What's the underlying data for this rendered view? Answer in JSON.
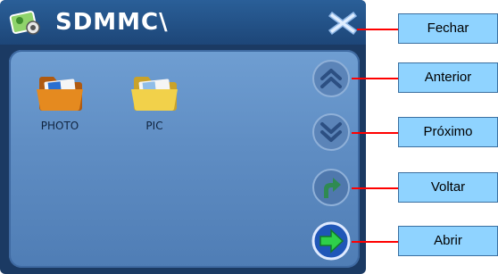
{
  "window": {
    "title": "SDMMC\\"
  },
  "icons": {
    "app": "photo-app-icon",
    "close": "close-icon",
    "folder": "folder-icon",
    "up": "double-chevron-up-icon",
    "down": "double-chevron-down-icon",
    "back": "return-arrow-icon",
    "open": "right-arrow-icon"
  },
  "folders": [
    {
      "label": "PHOTO",
      "color": "#e58a1f"
    },
    {
      "label": "PIC",
      "color": "#f2d14a"
    }
  ],
  "callouts": {
    "fechar": "Fechar",
    "anterior": "Anterior",
    "proximo": "Próximo",
    "voltar": "Voltar",
    "abrir": "Abrir"
  },
  "colors": {
    "callout_fill": "#8fd3ff",
    "callout_line": "#ff0000"
  }
}
